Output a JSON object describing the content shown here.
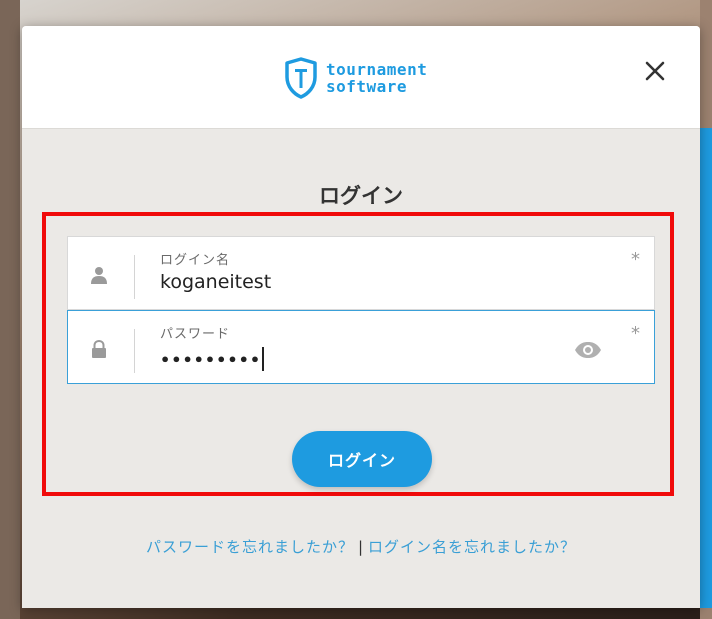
{
  "brand": {
    "line1": "tournament",
    "line2": "software",
    "color": "#1e9be0"
  },
  "dialog": {
    "title": "ログイン",
    "close_icon": "close-icon"
  },
  "form": {
    "username": {
      "label": "ログイン名",
      "value": "koganeitest",
      "required_mark": "*",
      "icon": "user-icon"
    },
    "password": {
      "label": "パスワード",
      "value": "•••••••••",
      "required_mark": "*",
      "icon": "lock-icon",
      "reveal_icon": "eye-icon"
    },
    "submit_label": "ログイン"
  },
  "links": {
    "forgot_password": "パスワードを忘れましたか？",
    "separator": "|",
    "forgot_username": "ログイン名を忘れましたか？"
  },
  "colors": {
    "accent": "#1e9be0",
    "highlight": "#f00a0a"
  }
}
